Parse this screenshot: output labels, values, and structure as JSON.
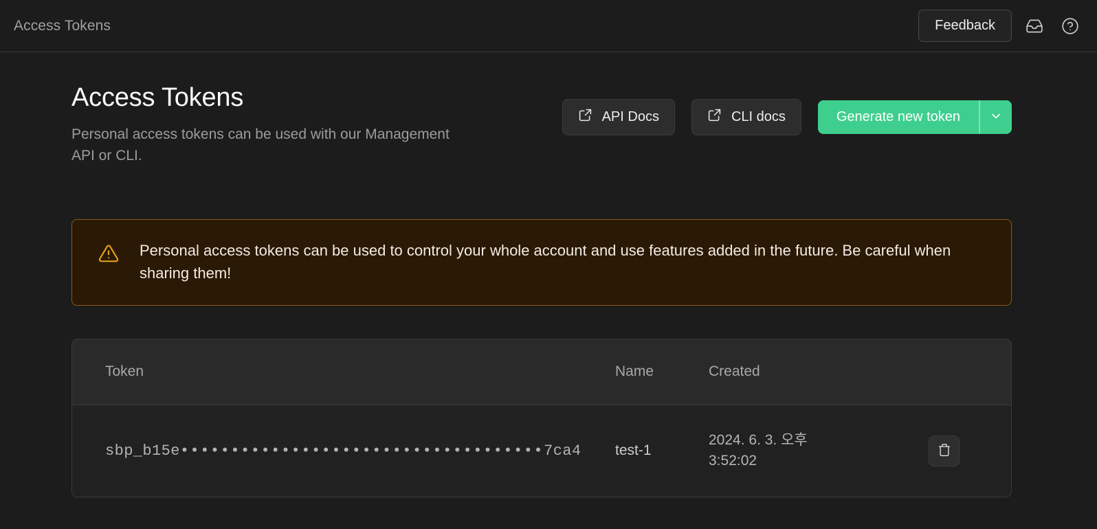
{
  "topbar": {
    "title": "Access Tokens",
    "feedback_label": "Feedback",
    "inbox_icon": "inbox-icon",
    "help_icon": "help-circle-icon"
  },
  "page": {
    "title": "Access Tokens",
    "subtitle": "Personal access tokens can be used with our Management API or CLI."
  },
  "actions": {
    "api_docs_label": "API Docs",
    "cli_docs_label": "CLI docs",
    "generate_label": "Generate new token",
    "caret_icon": "chevron-down-icon",
    "external_icon": "external-link-icon",
    "generate_color": "#3ecf8e"
  },
  "warning": {
    "icon": "alert-triangle-icon",
    "text": "Personal access tokens can be used to control your whole account and use features added in the future. Be careful when sharing them!",
    "border_color": "#8a5a12",
    "background_color": "#2a1905",
    "icon_color": "#e8a317"
  },
  "table": {
    "columns": [
      "Token",
      "Name",
      "Created"
    ],
    "rows": [
      {
        "token_prefix": "sbp_b15e",
        "token_mask": "••••••••••••••••••••••••••••••••••••",
        "token_suffix": "7ca4",
        "name": "test-1",
        "created": "2024. 6. 3. 오후 3:52:02",
        "delete_icon": "trash-icon"
      }
    ]
  }
}
